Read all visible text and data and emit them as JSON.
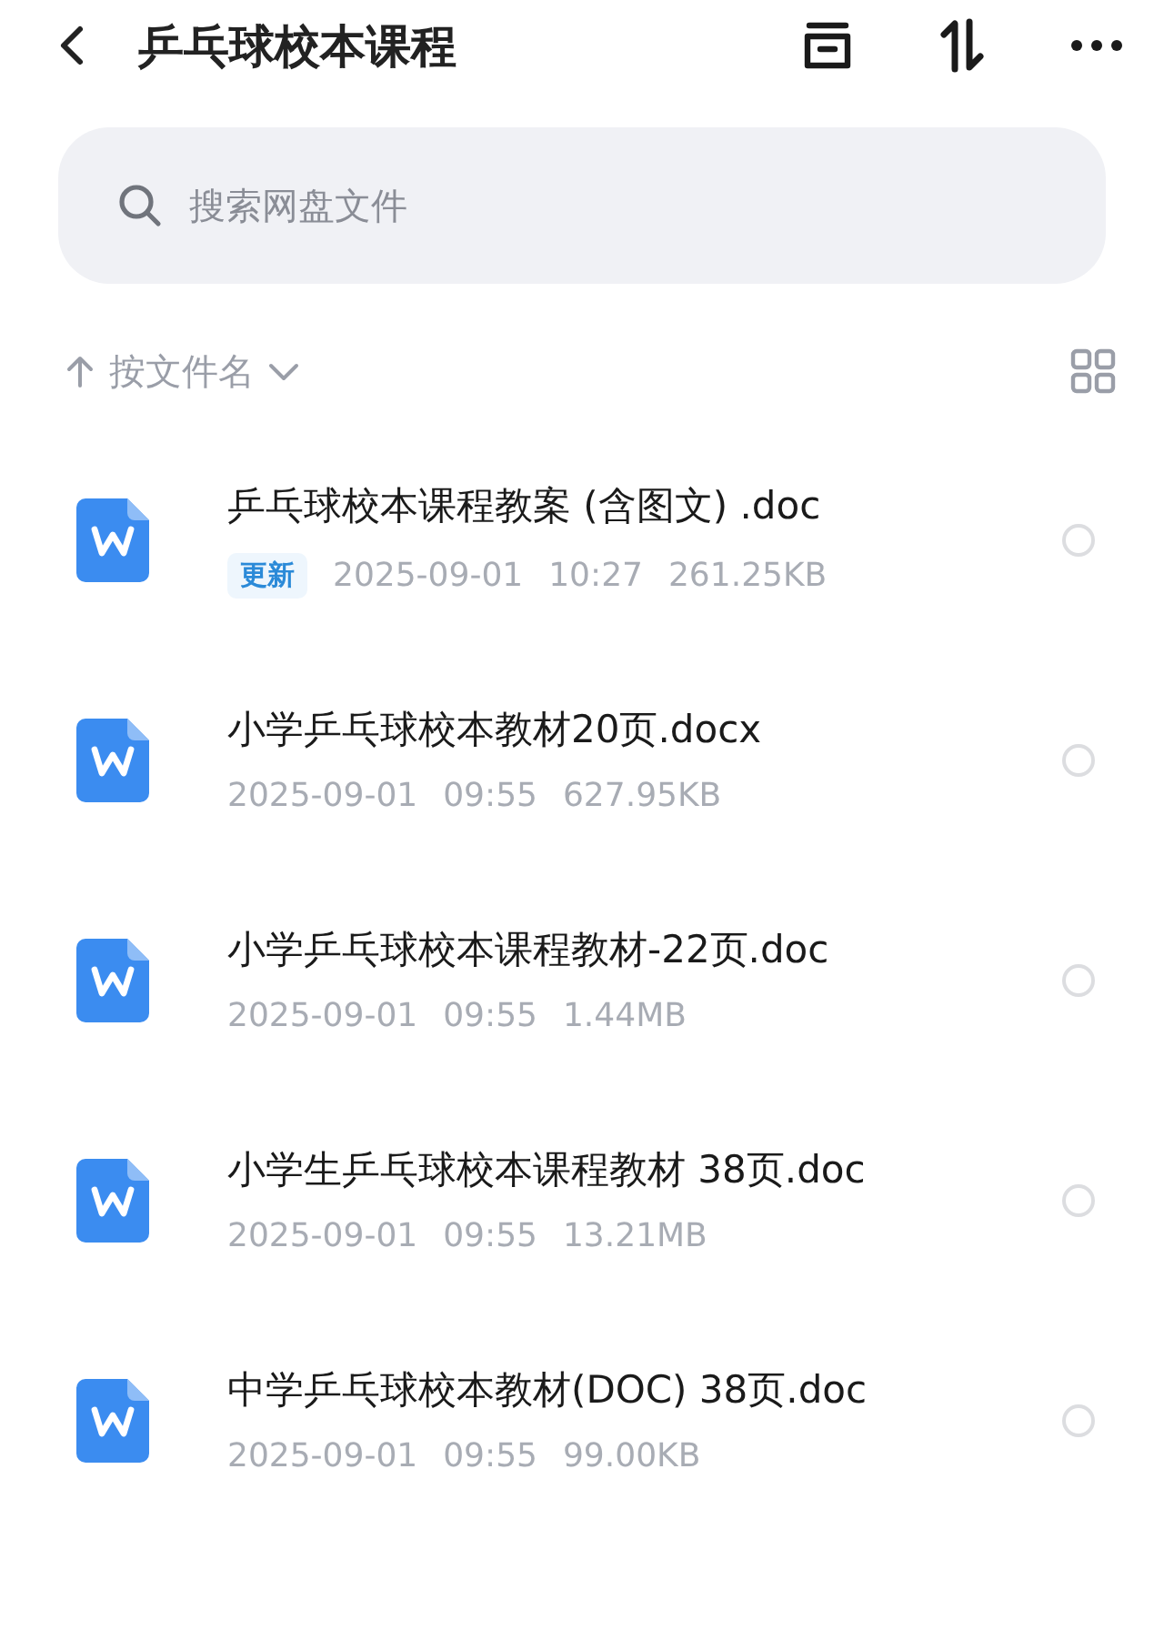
{
  "header": {
    "title": "乒乓球校本课程"
  },
  "search": {
    "placeholder": "搜索网盘文件"
  },
  "sort": {
    "label": "按文件名"
  },
  "files": [
    {
      "name": "乒乓球校本课程教案 (含图文) .doc",
      "badge": "更新",
      "date": "2025-09-01",
      "time": "10:27",
      "size": "261.25KB",
      "selected": false
    },
    {
      "name": "小学乒乓球校本教材20页.docx",
      "date": "2025-09-01",
      "time": "09:55",
      "size": "627.95KB",
      "selected": false
    },
    {
      "name": "小学乒乓球校本课程教材-22页.doc",
      "date": "2025-09-01",
      "time": "09:55",
      "size": "1.44MB",
      "selected": false
    },
    {
      "name": "小学生乒乓球校本课程教材 38页.doc",
      "date": "2025-09-01",
      "time": "09:55",
      "size": "13.21MB",
      "selected": false
    },
    {
      "name": "中学乒乓球校本教材(DOC) 38页.doc",
      "date": "2025-09-01",
      "time": "09:55",
      "size": "99.00KB",
      "selected": false
    }
  ]
}
